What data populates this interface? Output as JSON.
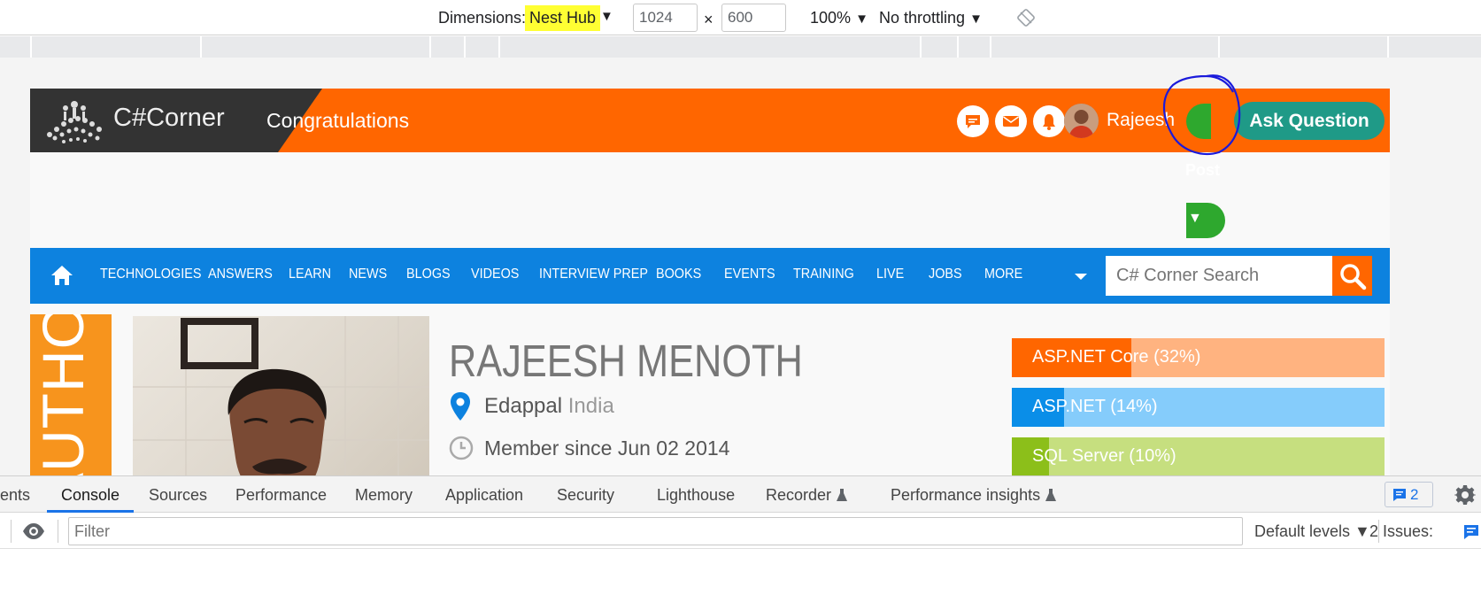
{
  "device_toolbar": {
    "dimensions_label": "Dimensions:",
    "device": "Nest Hub",
    "width": "1024",
    "height": "600",
    "times": "×",
    "zoom": "100%",
    "throttling": "No throttling",
    "arrow": "▼"
  },
  "header": {
    "logo_text": "C#Corner",
    "congrats": "Congratulations",
    "username": "Rajeesh",
    "post_label": "Post",
    "post_arrow": "▼",
    "ask_question": "Ask Question",
    "brand_color": "#ff6600"
  },
  "nav": {
    "items": [
      "TECHNOLOGIES",
      "ANSWERS",
      "LEARN",
      "NEWS",
      "BLOGS",
      "VIDEOS",
      "INTERVIEW PREP",
      "BOOKS",
      "EVENTS",
      "TRAINING",
      "LIVE",
      "JOBS",
      "MORE"
    ],
    "search_placeholder": "C# Corner Search",
    "nav_color": "#0d82df"
  },
  "profile": {
    "tab_label": "AUTHOR",
    "name": "RAJEESH MENOTH",
    "city": "Edappal",
    "country": "India",
    "member_since": "Member since Jun 02 2014"
  },
  "skills": [
    {
      "label": "ASP.NET Core (32%)",
      "percent": 32,
      "dark": "#ff6600",
      "light": "#ffb380"
    },
    {
      "label": "ASP.NET (14%)",
      "percent": 14,
      "dark": "#0a8ee8",
      "light": "#85ccfb"
    },
    {
      "label": "SQL Server (10%)",
      "percent": 10,
      "dark": "#8cbf1a",
      "light": "#c6df7f"
    }
  ],
  "devtools": {
    "tabs": [
      "ents",
      "Console",
      "Sources",
      "Performance",
      "Memory",
      "Application",
      "Security",
      "Lighthouse",
      "Recorder",
      "Performance insights"
    ],
    "message_count": "2",
    "filter_placeholder": "Filter",
    "levels": "Default levels ▼",
    "issues": "2 Issues:"
  }
}
